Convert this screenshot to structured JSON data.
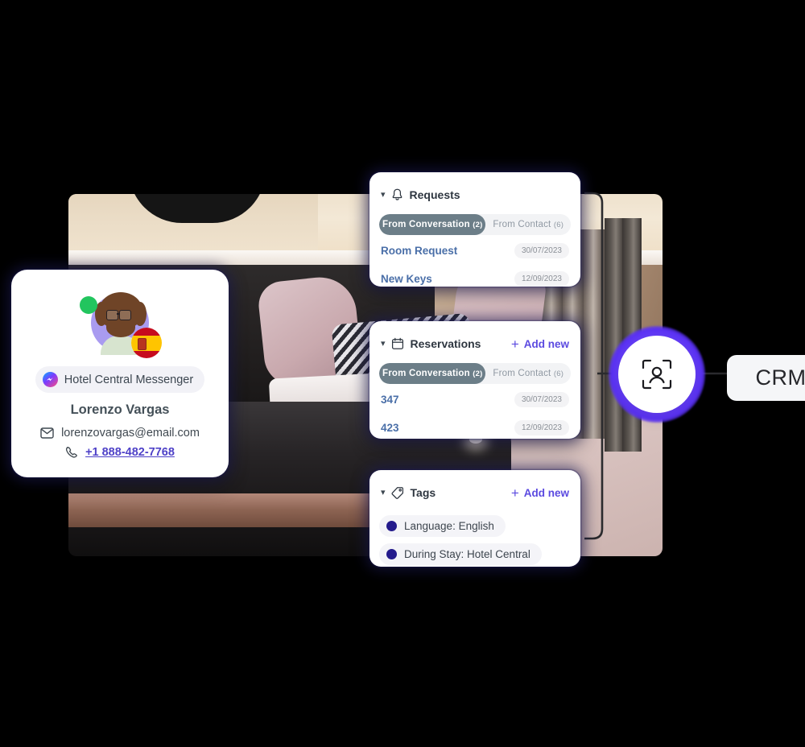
{
  "scene": {
    "background_photo": "hotel-room-photo",
    "accent_purple": "#5b4ae0",
    "glow_purple": "#6a43ff",
    "card_glow": "#1c1955"
  },
  "crm": {
    "label": "CRM"
  },
  "scan_node": {
    "icon": "user-scan-icon"
  },
  "contact_card": {
    "avatar": {
      "icon": "avatar",
      "status": "online",
      "status_color": "#22c55e",
      "flag": "spain-flag"
    },
    "channel": {
      "icon": "messenger-icon",
      "label": "Hotel Central Messenger"
    },
    "name": "Lorenzo Vargas",
    "email": {
      "icon": "envelope-icon",
      "value": "lorenzovargas@email.com"
    },
    "phone": {
      "icon": "phone-icon",
      "value": "+1 888-482-7768"
    }
  },
  "requests_panel": {
    "icon": "bell-icon",
    "chevron": "chevron-down-icon",
    "title": "Requests",
    "tabs": [
      {
        "label": "From Conversation",
        "count": "(2)",
        "active": true
      },
      {
        "label": "From Contact",
        "count": "(6)",
        "active": false
      }
    ],
    "rows": [
      {
        "label": "Room Request",
        "date": "30/07/2023"
      },
      {
        "label": "New Keys",
        "date": "12/09/2023"
      }
    ]
  },
  "reservations_panel": {
    "icon": "calendar-icon",
    "chevron": "chevron-down-icon",
    "title": "Reservations",
    "add_new": "Add new",
    "add_icon": "plus-icon",
    "tabs": [
      {
        "label": "From Conversation",
        "count": "(2)",
        "active": true
      },
      {
        "label": "From Contact",
        "count": "(6)",
        "active": false
      }
    ],
    "rows": [
      {
        "label": "347",
        "date": "30/07/2023"
      },
      {
        "label": "423",
        "date": "12/09/2023"
      }
    ]
  },
  "tags_panel": {
    "icon": "tag-icon",
    "chevron": "chevron-down-icon",
    "title": "Tags",
    "add_new": "Add new",
    "add_icon": "plus-icon",
    "tags": [
      {
        "label": "Language: English",
        "color": "#241b8c"
      },
      {
        "label": "During Stay: Hotel Central",
        "color": "#241b8c"
      }
    ]
  }
}
